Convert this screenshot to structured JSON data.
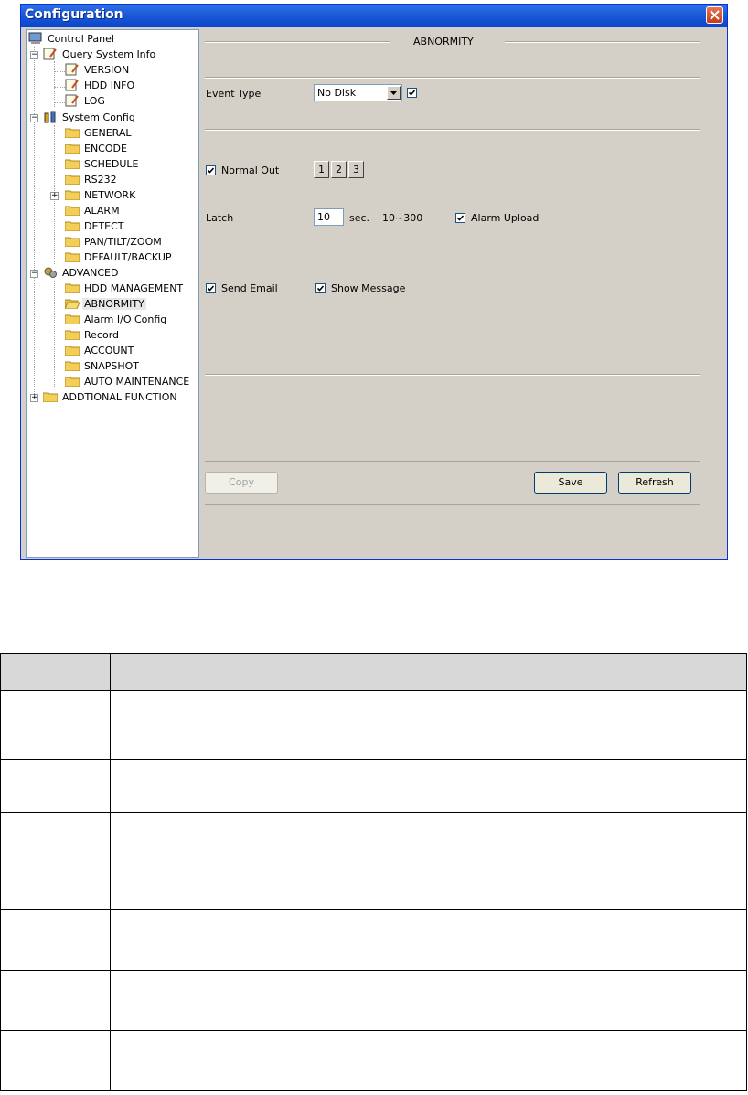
{
  "window": {
    "title": "Configuration"
  },
  "tree": {
    "items": [
      {
        "label": "Control Panel",
        "icon": "computer-icon"
      },
      {
        "label": "Query System Info",
        "icon": "notepad-icon"
      },
      {
        "label": "VERSION",
        "icon": "notepad-icon"
      },
      {
        "label": "HDD INFO",
        "icon": "notepad-icon"
      },
      {
        "label": "LOG",
        "icon": "notepad-icon"
      },
      {
        "label": "System Config",
        "icon": "tools-icon"
      },
      {
        "label": "GENERAL",
        "icon": "folder-icon"
      },
      {
        "label": "ENCODE",
        "icon": "folder-icon"
      },
      {
        "label": "SCHEDULE",
        "icon": "folder-icon"
      },
      {
        "label": "RS232",
        "icon": "folder-icon"
      },
      {
        "label": "NETWORK",
        "icon": "folder-icon"
      },
      {
        "label": "ALARM",
        "icon": "folder-icon"
      },
      {
        "label": "DETECT",
        "icon": "folder-icon"
      },
      {
        "label": "PAN/TILT/ZOOM",
        "icon": "folder-icon"
      },
      {
        "label": "DEFAULT/BACKUP",
        "icon": "folder-icon"
      },
      {
        "label": "ADVANCED",
        "icon": "gears-icon"
      },
      {
        "label": "HDD MANAGEMENT",
        "icon": "folder-icon"
      },
      {
        "label": "ABNORMITY",
        "icon": "folder-open-icon"
      },
      {
        "label": "Alarm I/O Config",
        "icon": "folder-icon"
      },
      {
        "label": "Record",
        "icon": "folder-icon"
      },
      {
        "label": "ACCOUNT",
        "icon": "folder-icon"
      },
      {
        "label": "SNAPSHOT",
        "icon": "folder-icon"
      },
      {
        "label": "AUTO MAINTENANCE",
        "icon": "folder-icon"
      },
      {
        "label": "ADDTIONAL FUNCTION",
        "icon": "folder-icon"
      }
    ],
    "selected": "ABNORMITY"
  },
  "panel": {
    "section_title": "ABNORMITY",
    "event_type_label": "Event Type",
    "event_type_value": "No Disk",
    "event_enable_checked": true,
    "normal_out_label": "Normal Out",
    "normal_out_checked": true,
    "outputs": [
      "1",
      "2",
      "3"
    ],
    "latch_label": "Latch",
    "latch_value": "10",
    "latch_unit": "sec.",
    "latch_range": "10~300",
    "alarm_upload_label": "Alarm Upload",
    "alarm_upload_checked": true,
    "send_email_label": "Send Email",
    "send_email_checked": true,
    "show_message_label": "Show Message",
    "show_message_checked": true,
    "copy_label": "Copy",
    "save_label": "Save",
    "refresh_label": "Refresh"
  },
  "table": {
    "rows": 7
  },
  "colors": {
    "titlebar": "#0a46cc",
    "dialog_bg": "#d4d0c8",
    "table_header_bg": "#d8d8d8"
  }
}
